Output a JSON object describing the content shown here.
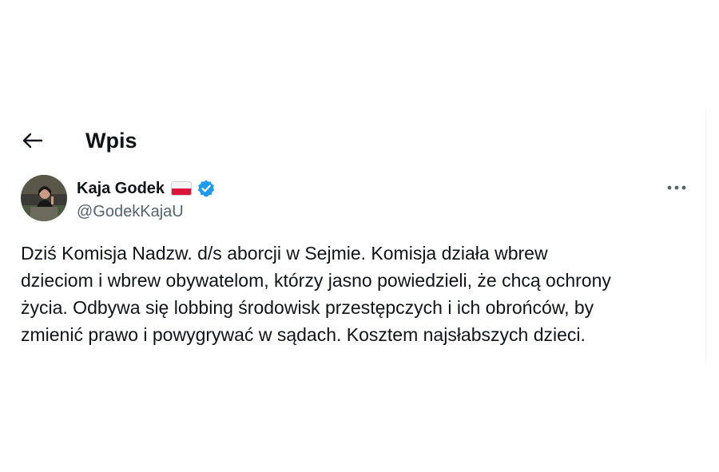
{
  "header": {
    "title": "Wpis",
    "back_icon": "arrow-left-icon"
  },
  "author": {
    "display_name": "Kaja Godek",
    "flag": "poland-flag",
    "verified_icon": "verified-badge-icon",
    "verified_color": "#1d9bf0",
    "handle": "@GodekKajaU"
  },
  "more_icon": "more-horizontal-icon",
  "tweet": {
    "text": "Dziś Komisja Nadzw. d/s aborcji w Sejmie. Komisja działa wbrew\ndzieciom i wbrew obywatelom, którzy jasno powiedzieli, że chcą ochrony\nżycia. Odbywa się lobbing środowisk przestępczych i ich obrońców, by\nzmienić prawo i powygrywać w sądach. Kosztem najsłabszych dzieci."
  }
}
